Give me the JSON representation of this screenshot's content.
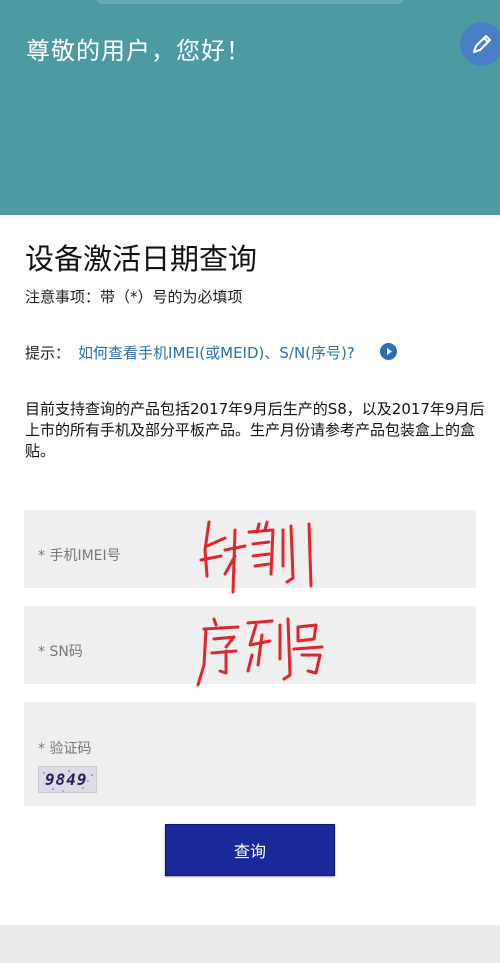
{
  "header": {
    "greeting": "尊敬的用户，您好！",
    "bg_color": "#4c9aa2",
    "edit_icon": "pencil-icon",
    "edit_button_color": "#4a7fc6"
  },
  "page": {
    "title": "设备激活日期查询",
    "notice": "注意事项：带（*）号的为必填项",
    "tip_label": "提示：",
    "tip_link": "如何查看手机IMEI(或MEID)、S/N(序号)?",
    "tip_icon": "play-circle-icon",
    "description": "目前支持查询的产品包括2017年9月后生产的S8，以及2017年9月后上市的所有手机及部分平板产品。生产月份请参考产品包装盒上的盒贴。"
  },
  "form": {
    "imei_label": "* 手机IMEI号",
    "sn_label": "* SN码",
    "captcha_label": "* 验证码",
    "captcha_text": "9849",
    "submit_label": "查询",
    "submit_color": "#1a2a9b"
  },
  "annotations": {
    "imei_handwriting": "卡槽1",
    "sn_handwriting": "序列号",
    "ink_color": "#e0262b"
  }
}
